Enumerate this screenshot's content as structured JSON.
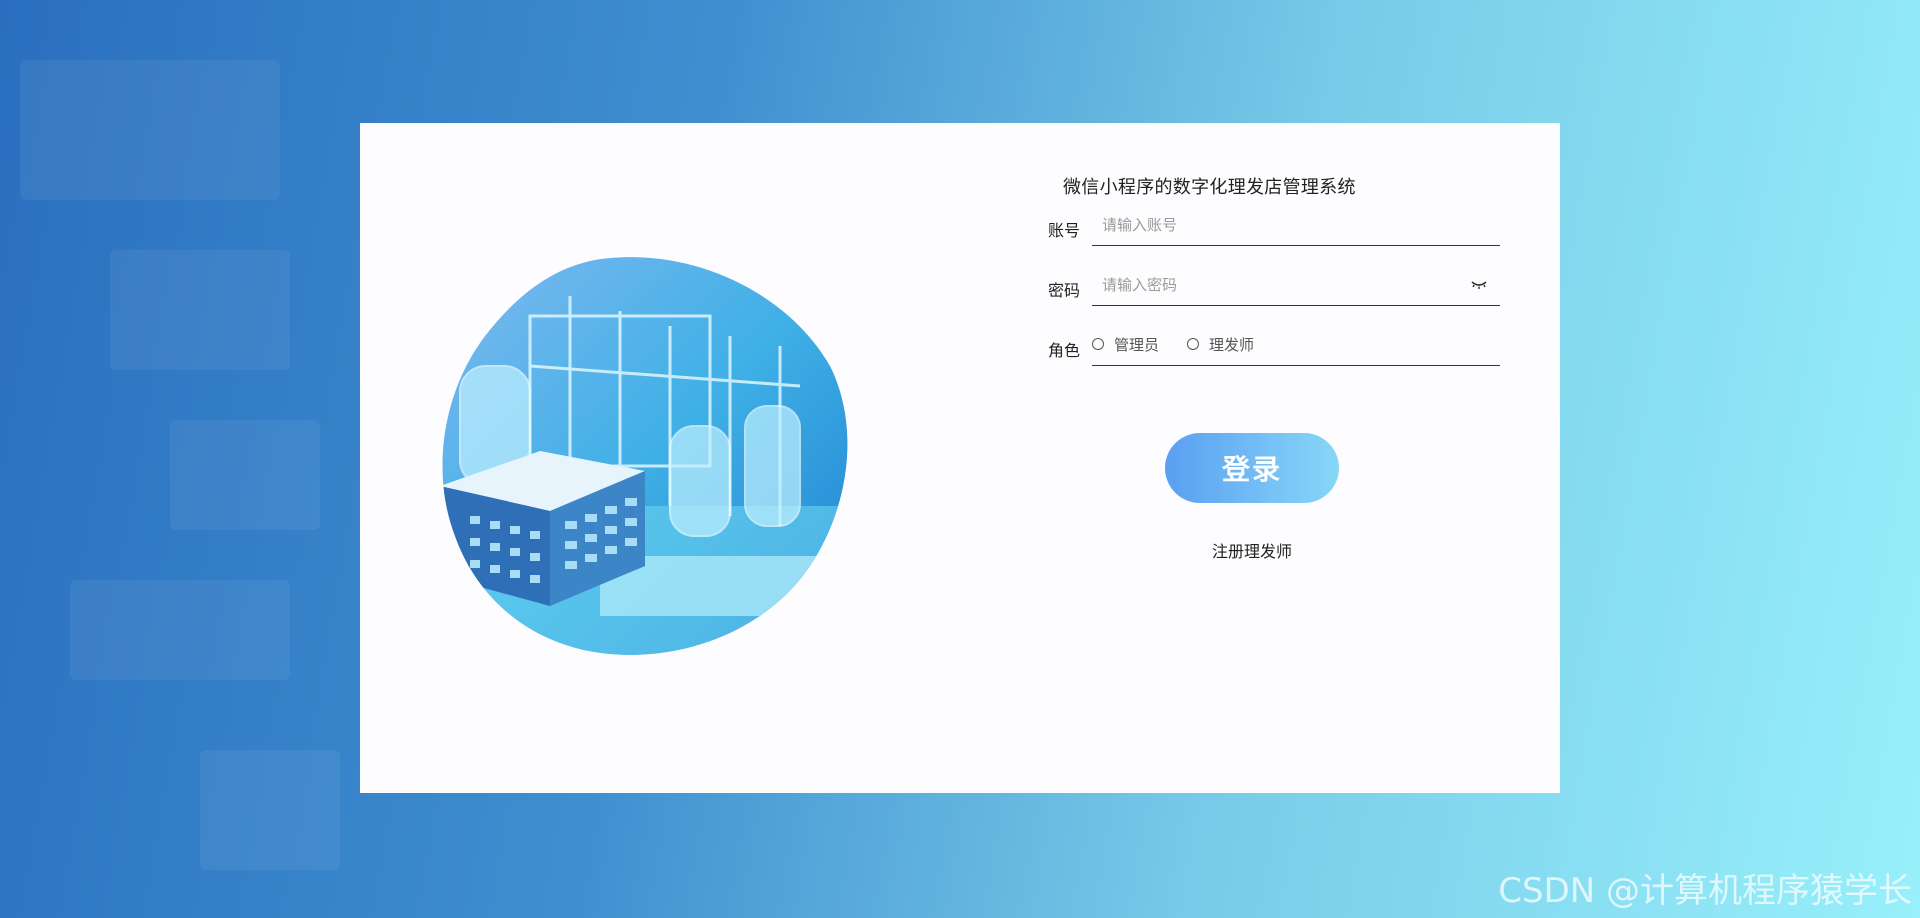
{
  "app": {
    "title": "微信小程序的数字化理发店管理系统"
  },
  "form": {
    "account": {
      "label": "账号",
      "placeholder": "请输入账号",
      "value": ""
    },
    "password": {
      "label": "密码",
      "placeholder": "请输入密码",
      "value": ""
    },
    "role": {
      "label": "角色",
      "options": [
        {
          "label": "管理员",
          "selected": false
        },
        {
          "label": "理发师",
          "selected": false
        }
      ]
    },
    "login_label": "登录",
    "register_label": "注册理发师"
  },
  "watermark": "CSDN @计算机程序猿学长",
  "colors": {
    "bg_start": "#2a6fbf",
    "bg_end": "#98f0fb",
    "button_start": "#5a9ff2",
    "button_end": "#88d7f8"
  },
  "icons": {
    "password_toggle": "eye-closed-icon",
    "hero": "factory-illustration"
  }
}
